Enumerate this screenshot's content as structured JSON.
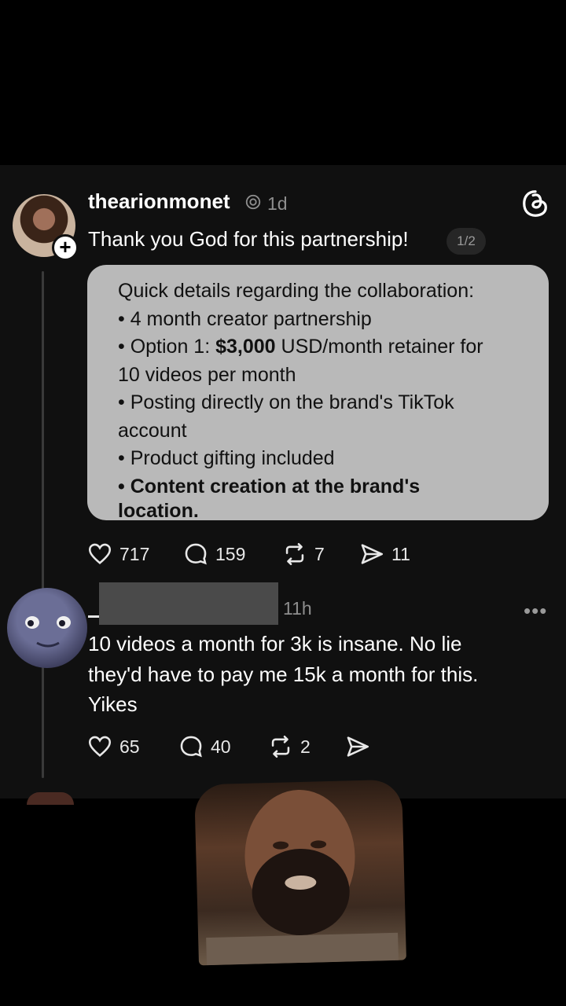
{
  "post": {
    "username": "thearionmonet",
    "time": "1d",
    "text": "Thank you God for this partnership!",
    "pager": "1/2",
    "card": {
      "heading": "Quick details regarding the collaboration:",
      "line1": "• 4 month creator partnership",
      "line2_prefix": "• Option 1: ",
      "line2_bold": "$3,000",
      "line2_suffix": " USD/month retainer for",
      "line3": "10 videos per month",
      "line4": "• Posting directly on the brand's TikTok",
      "line5": "account",
      "line6": "• Product gifting included",
      "line7": "• Content creation at the brand's",
      "line8": "location."
    },
    "stats": {
      "likes": "717",
      "comments": "159",
      "reposts": "7",
      "shares": "11"
    }
  },
  "reply": {
    "time": "11h",
    "more": "•••",
    "text_line1": "10 videos a month for 3k is insane.  No lie",
    "text_line2": "they'd have to pay me 15k a month for this.",
    "text_line3": "Yikes",
    "stats": {
      "likes": "65",
      "comments": "40",
      "reposts": "2"
    }
  },
  "icons": {
    "like": "heart-icon",
    "comment": "speech-bubble-icon",
    "repost": "repost-icon",
    "share": "send-icon",
    "app": "threads-logo-icon",
    "verified": "verified-badge-icon"
  },
  "colors": {
    "background": "#000000",
    "panel": "#101010",
    "card": "#b9b9b9",
    "muted": "#8e8e8e"
  }
}
